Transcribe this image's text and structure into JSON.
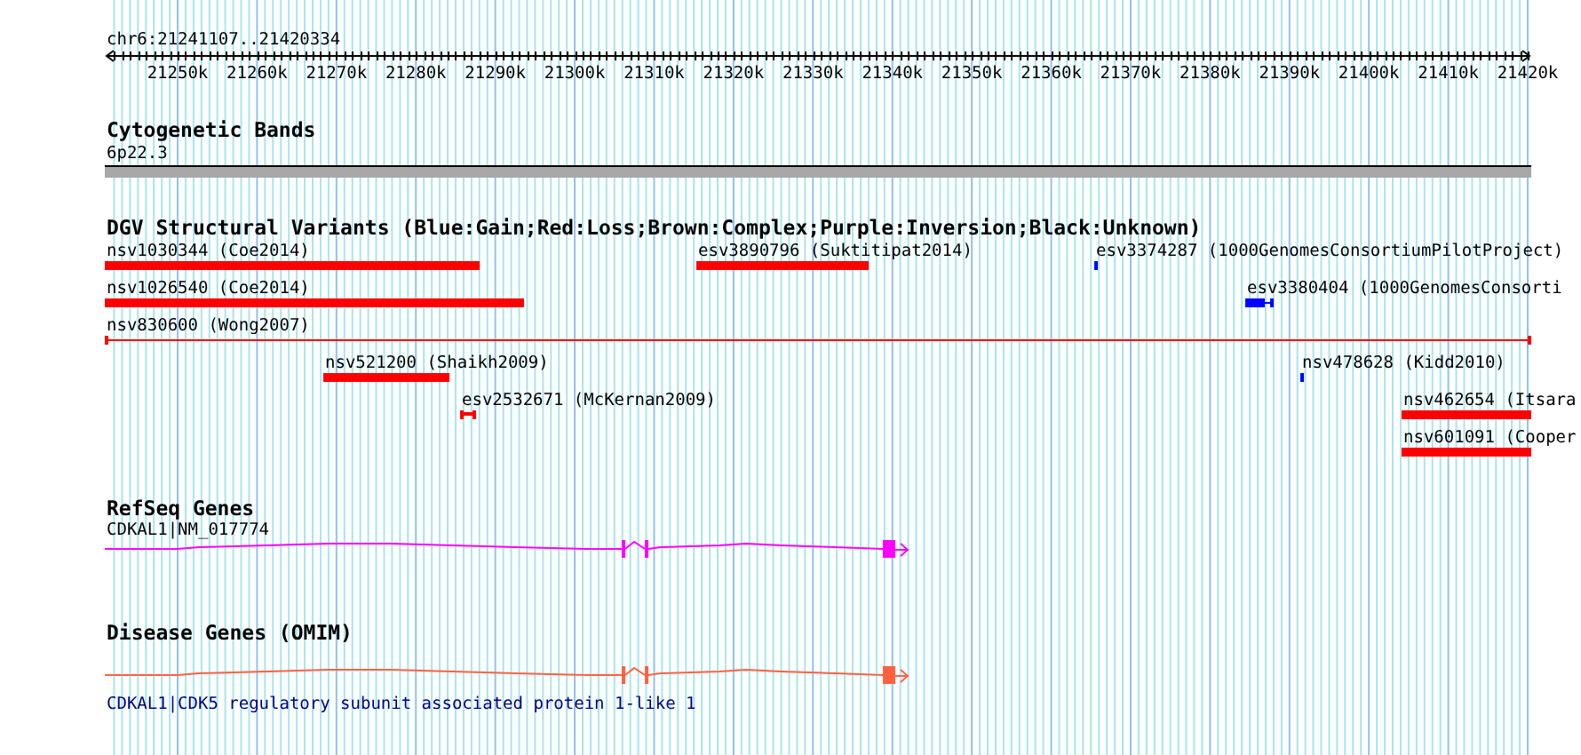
{
  "location": "chr6:21241107..21420334",
  "ruler": {
    "ticks": [
      "21250k",
      "21260k",
      "21270k",
      "21280k",
      "21290k",
      "21300k",
      "21310k",
      "21320k",
      "21330k",
      "21340k",
      "21350k",
      "21360k",
      "21370k",
      "21380k",
      "21390k",
      "21400k",
      "21410k",
      "21420k"
    ]
  },
  "tracks": [
    {
      "kind": "cytoband",
      "title": "Cytogenetic Bands",
      "band": "6p22.3"
    },
    {
      "kind": "variants",
      "title": "DGV Structural Variants (Blue:Gain;Red:Loss;Brown:Complex;Purple:Inversion;Black:Unknown)",
      "features": [
        {
          "label": "nsv1030344 (Coe2014)",
          "color": "#ff0000"
        },
        {
          "label": "esv3890796 (Suktitipat2014)",
          "color": "#ff0000"
        },
        {
          "label": "esv3374287 (1000GenomesConsortiumPilotProject)",
          "color": "#0000ff"
        },
        {
          "label": "nsv1026540 (Coe2014)",
          "color": "#ff0000"
        },
        {
          "label": "esv3380404 (1000GenomesConsorti",
          "color": "#0000ff"
        },
        {
          "label": "nsv830600 (Wong2007)",
          "color": "#ff0000"
        },
        {
          "label": "nsv521200 (Shaikh2009)",
          "color": "#ff0000"
        },
        {
          "label": "nsv478628 (Kidd2010)",
          "color": "#0000ff"
        },
        {
          "label": "esv2532671 (McKernan2009)",
          "color": "#ff0000"
        },
        {
          "label": "nsv462654 (Itsara",
          "color": "#ff0000"
        },
        {
          "label": "nsv601091 (Cooper",
          "color": "#ff0000"
        }
      ]
    },
    {
      "kind": "gene",
      "title": "RefSeq Genes",
      "label": "CDKAL1|NM_017774",
      "color": "#ff00ff"
    },
    {
      "kind": "gene",
      "title": "Disease Genes (OMIM)",
      "description": "CDKAL1|CDK5 regulatory subunit associated protein 1-like 1",
      "color": "#ff6040"
    }
  ]
}
